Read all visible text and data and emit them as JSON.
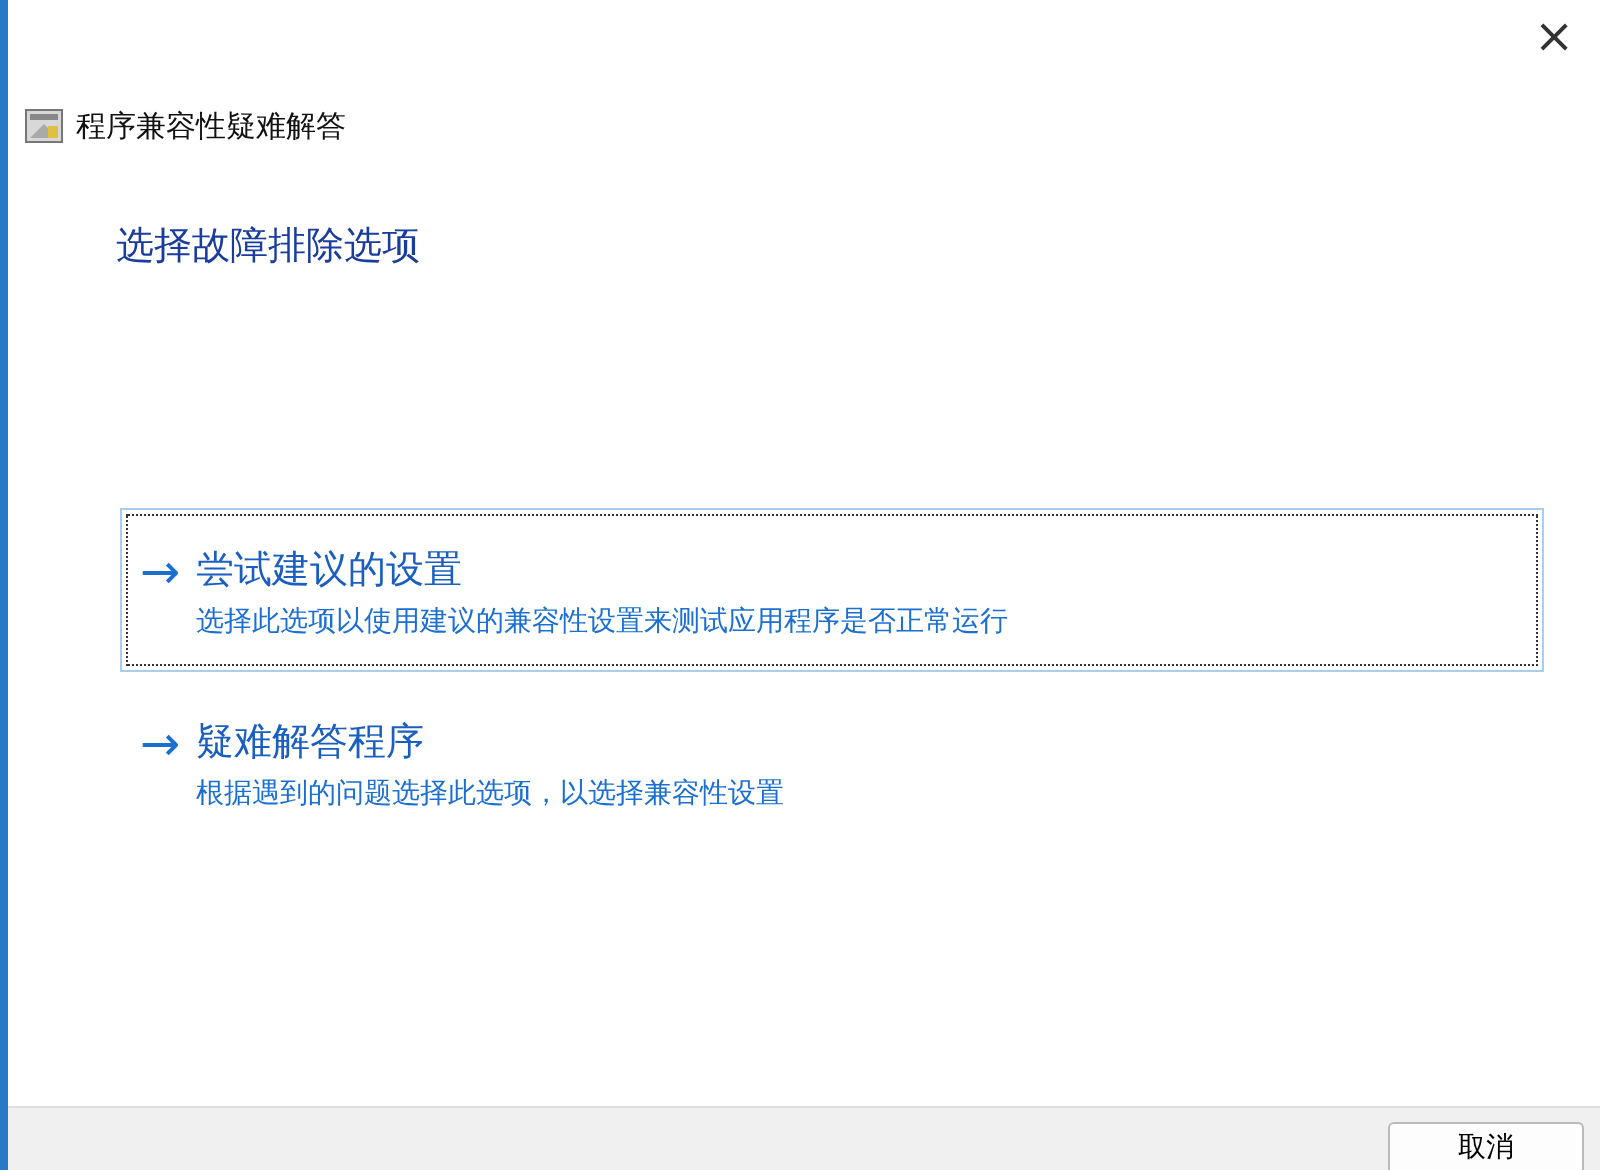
{
  "window": {
    "close": "×",
    "title": "程序兼容性疑难解答"
  },
  "heading": "选择故障排除选项",
  "options": [
    {
      "arrow": "→",
      "title": "尝试建议的设置",
      "description": "选择此选项以使用建议的兼容性设置来测试应用程序是否正常运行",
      "selected": true
    },
    {
      "arrow": "→",
      "title": "疑难解答程序",
      "description": "根据遇到的问题选择此选项，以选择兼容性设置",
      "selected": false
    }
  ],
  "buttons": [
    "取消"
  ]
}
